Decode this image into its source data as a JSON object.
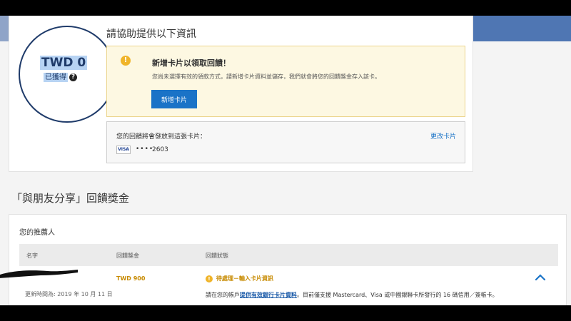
{
  "reward_summary": {
    "amount": "TWD 0",
    "obtained_label": "已獲得",
    "help_icon": "question-circle-icon"
  },
  "form": {
    "title": "請協助提供以下資訊",
    "alert": {
      "icon": "exclamation-circle-icon",
      "title": "新增卡片以領取回饋！",
      "body": "您尚未選擇有效的領款方式，請新增卡片資料並儲存，我們就會將您的回饋獎金存入該卡。",
      "button_label": "新增卡片"
    },
    "payout_card": {
      "label": "您的回饋將會發放到這張卡片：",
      "change_link": "更改卡片",
      "brand": "VISA",
      "masked": "••••",
      "last4": "2603"
    }
  },
  "referral": {
    "section_title": "「與朋友分享」回饋獎金",
    "heading": "您的推薦人",
    "columns": [
      "名字",
      "回饋獎金",
      "回饋狀態"
    ],
    "row": {
      "reward": "TWD 900",
      "status": "待處理－輸入卡片資訊",
      "updated": "更新時間為: 2019 年 10 月 11 日",
      "note_prefix": "請在您的帳戶",
      "note_link": "提供有效銀行卡片資料",
      "note_suffix": "。目前僅支援 Mastercard、Visa 或中國銀聯卡所發行的 16 碼信用／簽帳卡。"
    }
  },
  "colors": {
    "brand_blue": "#4f76b3",
    "accent_blue": "#1a73c7",
    "warning_yellow": "#f0b429",
    "warning_text": "#c78a00",
    "navy": "#1f3b6a"
  }
}
